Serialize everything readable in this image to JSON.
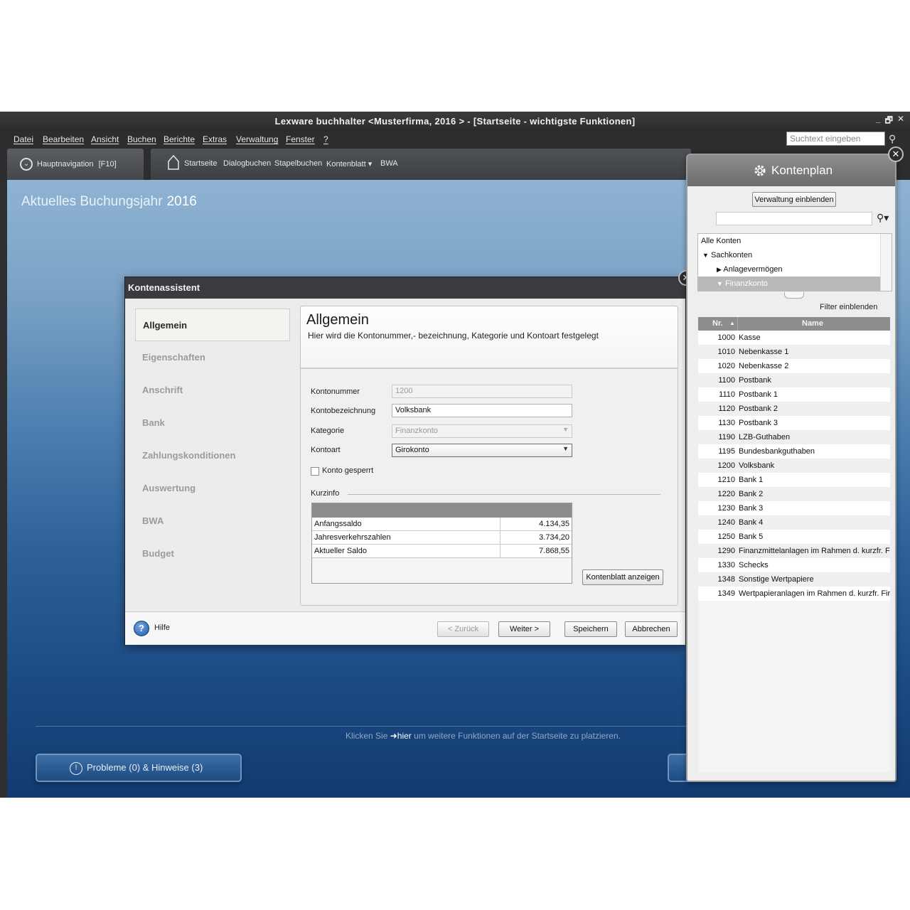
{
  "window": {
    "title": "Lexware buchhalter <Musterfirma,  2016 > - [Startseite - wichtigste Funktionen]",
    "controls": [
      "_",
      "🗗",
      "✕"
    ]
  },
  "menu": {
    "items": [
      "Datei",
      "Bearbeiten",
      "Ansicht",
      "Buchen",
      "Berichte",
      "Extras",
      "Verwaltung",
      "Fenster",
      "?"
    ],
    "search_placeholder": "Suchtext eingeben"
  },
  "nav": {
    "hauptnavigation": "Hauptnavigation",
    "hauptnavigation_key": "[F10]",
    "shortcuts": [
      "Startseite",
      "Dialogbuchen",
      "Stapelbuchen",
      "Kontenblatt ▾",
      "BWA"
    ]
  },
  "home": {
    "year_label": "Aktuelles Buchungsjahr",
    "year": "2016",
    "hint_before": "Klicken Sie",
    "hint_link": "hier",
    "hint_after": "um weitere Funktionen auf der Startseite zu platzieren.",
    "probleme_button": "Probleme (0) & Hinweise (3)"
  },
  "dialog": {
    "title": "Kontenassistent",
    "nav": [
      "Allgemein",
      "Eigenschaften",
      "Anschrift",
      "Bank",
      "Zahlungskonditionen",
      "Auswertung",
      "BWA",
      "Budget"
    ],
    "content_title": "Allgemein",
    "content_subtitle": "Hier wird die Kontonummer,- bezeichnung, Kategorie und Kontoart festgelegt",
    "fields": {
      "kontonummer_label": "Kontonummer",
      "kontonummer": "1200",
      "kontobezeichnung_label": "Kontobezeichnung",
      "kontobezeichnung": "Volksbank",
      "kategorie_label": "Kategorie",
      "kategorie": "Finanzkonto",
      "kontoart_label": "Kontoart",
      "kontoart": "Girokonto",
      "konto_gesperrt_label": "Konto gesperrt"
    },
    "kurzinfo": {
      "label": "Kurzinfo",
      "rows": [
        {
          "label": "Anfangssaldo",
          "value": "4.134,35"
        },
        {
          "label": "Jahresverkehrszahlen",
          "value": "3.734,20"
        },
        {
          "label": "Aktueller Saldo",
          "value": "7.868,55"
        }
      ],
      "button": "Kontenblatt anzeigen"
    },
    "footer": {
      "help": "Hilfe",
      "back": "< Zurück",
      "next": "Weiter >",
      "save": "Speichern",
      "cancel": "Abbrechen"
    }
  },
  "kontenplan": {
    "title": "Kontenplan",
    "verwaltung_button": "Verwaltung einblenden",
    "tree": [
      {
        "label": "Alle Konten",
        "level": 0,
        "marker": ""
      },
      {
        "label": "Sachkonten",
        "level": 0,
        "marker": "▼"
      },
      {
        "label": "Anlagevermögen",
        "level": 1,
        "marker": "▶"
      },
      {
        "label": "Finanzkonto",
        "level": 1,
        "marker": "▼",
        "selected": true
      }
    ],
    "filter_label": "Filter einblenden",
    "columns": {
      "nr": "Nr.",
      "name": "Name"
    },
    "accounts": [
      {
        "nr": "1000",
        "name": "Kasse"
      },
      {
        "nr": "1010",
        "name": "Nebenkasse 1"
      },
      {
        "nr": "1020",
        "name": "Nebenkasse 2"
      },
      {
        "nr": "1100",
        "name": "Postbank"
      },
      {
        "nr": "1110",
        "name": "Postbank 1"
      },
      {
        "nr": "1120",
        "name": "Postbank 2"
      },
      {
        "nr": "1130",
        "name": "Postbank 3"
      },
      {
        "nr": "1190",
        "name": "LZB-Guthaben"
      },
      {
        "nr": "1195",
        "name": "Bundesbankguthaben"
      },
      {
        "nr": "1200",
        "name": "Volksbank"
      },
      {
        "nr": "1210",
        "name": "Bank 1"
      },
      {
        "nr": "1220",
        "name": "Bank 2"
      },
      {
        "nr": "1230",
        "name": "Bank 3"
      },
      {
        "nr": "1240",
        "name": "Bank 4"
      },
      {
        "nr": "1250",
        "name": "Bank 5"
      },
      {
        "nr": "1290",
        "name": "Finanzmittelanlagen im Rahmen d. kurzfr. Fi"
      },
      {
        "nr": "1330",
        "name": "Schecks"
      },
      {
        "nr": "1348",
        "name": "Sonstige Wertpapiere"
      },
      {
        "nr": "1349",
        "name": "Wertpapieranlagen im Rahmen d. kurzfr. Fir"
      }
    ]
  }
}
